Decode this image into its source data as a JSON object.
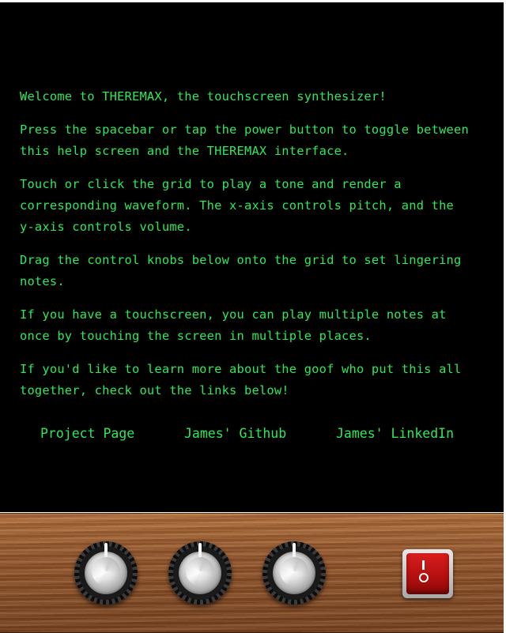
{
  "help": {
    "paragraphs": [
      "Welcome to THEREMAX, the touchscreen synthesizer!",
      "Press the spacebar or tap the power button to toggle between\nthis help screen and the THEREMAX interface.",
      "Touch or click the grid to play a tone and render a\ncorresponding waveform. The x-axis controls pitch, and the\ny-axis controls volume.",
      "Drag the control knobs below onto the grid to set lingering\nnotes.",
      "If you have a touchscreen, you can play multiple notes at\nonce by touching the screen in multiple places.",
      "If you'd like to learn more about the goof who put this all\ntogether, check out the links below!"
    ]
  },
  "links": {
    "project_page": "Project Page",
    "github": "James' Github",
    "linkedin": "James' LinkedIn"
  },
  "controls": {
    "knobs": [
      {
        "name": "knob-1"
      },
      {
        "name": "knob-2"
      },
      {
        "name": "knob-3"
      }
    ],
    "power_on_symbol": "I",
    "power_off_symbol": "O"
  },
  "colors": {
    "terminal_text": "#2ee85a",
    "screen_background": "#000000",
    "power_button": "#c41414"
  },
  "icons": {
    "knob": "control-knob-icon",
    "power": "power-switch-icon"
  }
}
